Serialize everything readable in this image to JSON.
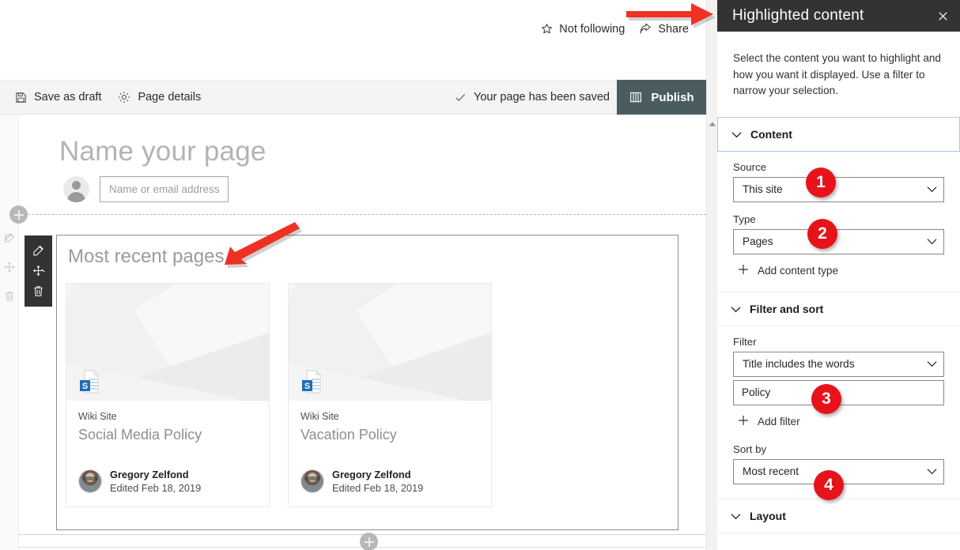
{
  "top_commands": [
    {
      "icon": "star-outline-icon",
      "label": "Not following"
    },
    {
      "icon": "share-icon",
      "label": "Share"
    }
  ],
  "command_bar": {
    "save_as_draft": "Save as draft",
    "page_details": "Page details",
    "status": "Your page has been saved",
    "publish": "Publish",
    "save_icon": "save-floppy-icon",
    "details_icon": "gear-icon",
    "status_icon": "checkmark-icon",
    "publish_icon": "book-icon"
  },
  "page": {
    "title_placeholder": "Name your page",
    "author_placeholder": "Name or email address"
  },
  "webpart": {
    "title": "Most recent pages",
    "toolbar": [
      {
        "icon": "edit-pencil-icon",
        "name": "edit-web-part"
      },
      {
        "icon": "move-arrows-icon",
        "name": "move-web-part"
      },
      {
        "icon": "trash-icon",
        "name": "delete-web-part"
      }
    ],
    "cards": [
      {
        "site": "Wiki Site",
        "name": "Social Media Policy",
        "author": "Gregory Zelfond",
        "edited": "Edited Feb 18, 2019"
      },
      {
        "site": "Wiki Site",
        "name": "Vacation Policy",
        "author": "Gregory Zelfond",
        "edited": "Edited Feb 18, 2019"
      }
    ]
  },
  "panel": {
    "title": "Highlighted content",
    "close_icon": "close-x-icon",
    "description": "Select the content you want to highlight and how you want it displayed. Use a filter to narrow your selection.",
    "sections": {
      "content": {
        "header": "Content",
        "source_label": "Source",
        "source_value": "This site",
        "type_label": "Type",
        "type_value": "Pages",
        "add_content_type": "Add content type"
      },
      "filter_sort": {
        "header": "Filter and sort",
        "filter_label": "Filter",
        "filter_value": "Title includes the words",
        "filter_text_value": "Policy",
        "add_filter": "Add filter",
        "sort_label": "Sort by",
        "sort_value": "Most recent"
      },
      "layout": {
        "header": "Layout"
      }
    }
  },
  "annotations": {
    "badges": [
      "1",
      "2",
      "3",
      "4"
    ],
    "accent_color": "#e8131a",
    "arrows": [
      "arrow-pointing-right-to-panel",
      "arrow-pointing-down-left-to-web-part-title"
    ]
  }
}
